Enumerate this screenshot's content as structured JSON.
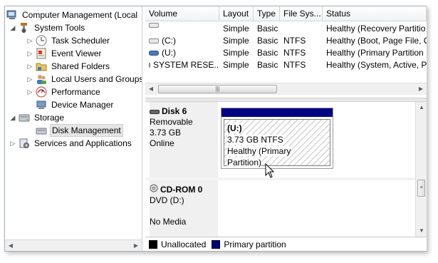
{
  "tree": {
    "root": "Computer Management (Local",
    "system_tools": "System Tools",
    "task_scheduler": "Task Scheduler",
    "event_viewer": "Event Viewer",
    "shared_folders": "Shared Folders",
    "local_users": "Local Users and Groups",
    "performance": "Performance",
    "device_manager": "Device Manager",
    "storage": "Storage",
    "disk_management": "Disk Management",
    "services_apps": "Services and Applications"
  },
  "volumes": {
    "headers": {
      "volume": "Volume",
      "layout": "Layout",
      "type": "Type",
      "filesystem": "File Sys...",
      "status": "Status"
    },
    "rows": [
      {
        "volume": "",
        "layout": "Simple",
        "type": "Basic",
        "fs": "",
        "status": "Healthy (Recovery Partitio"
      },
      {
        "volume": "(C:)",
        "layout": "Simple",
        "type": "Basic",
        "fs": "NTFS",
        "status": "Healthy (Boot, Page File, C"
      },
      {
        "volume": "(U:)",
        "layout": "Simple",
        "type": "Basic",
        "fs": "NTFS",
        "status": "Healthy (Primary Partition"
      },
      {
        "volume": "SYSTEM RESE...",
        "layout": "Simple",
        "type": "Basic",
        "fs": "NTFS",
        "status": "Healthy (System, Active, P"
      }
    ]
  },
  "disks": [
    {
      "name": "Disk 6",
      "kind": "Removable",
      "size": "3.73 GB",
      "state": "Online",
      "partition": {
        "letter": "(U:)",
        "size_fs": "3.73 GB NTFS",
        "status": "Healthy (Primary Partition)"
      }
    },
    {
      "name": "CD-ROM 0",
      "kind": "DVD (D:)",
      "state": "No Media"
    }
  ],
  "legend": {
    "unallocated": "Unallocated",
    "primary": "Primary partition"
  },
  "colors": {
    "unallocated": "#000000",
    "primary": "#020380",
    "selection": "#e5e5e5"
  }
}
